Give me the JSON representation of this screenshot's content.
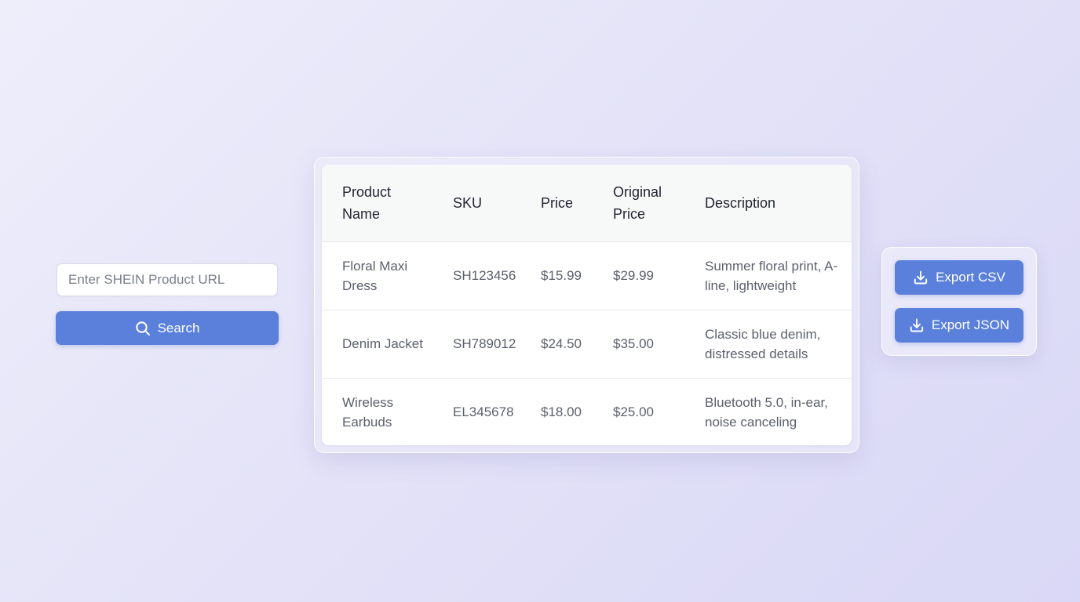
{
  "search": {
    "placeholder": "Enter SHEIN Product URL",
    "value": "",
    "button_label": "Search",
    "button_icon": "search-icon"
  },
  "table": {
    "columns": [
      "Product Name",
      "SKU",
      "Price",
      "Original Price",
      "Description"
    ],
    "rows": [
      {
        "name": "Floral Maxi Dress",
        "sku": "SH123456",
        "price": "$15.99",
        "original_price": "$29.99",
        "description": "Summer floral print, A-line, lightweight"
      },
      {
        "name": "Denim Jacket",
        "sku": "SH789012",
        "price": "$24.50",
        "original_price": "$35.00",
        "description": "Classic blue denim, distressed details"
      },
      {
        "name": "Wireless Earbuds",
        "sku": "EL345678",
        "price": "$18.00",
        "original_price": "$25.00",
        "description": "Bluetooth 5.0, in-ear, noise canceling"
      }
    ]
  },
  "export": {
    "csv_label": "Export CSV",
    "json_label": "Export JSON",
    "icon": "download-icon"
  },
  "colors": {
    "accent": "#5a80dc",
    "background_start": "#eeeefb",
    "background_end": "#d9d8f6",
    "header_bg": "#f7f8f8"
  }
}
